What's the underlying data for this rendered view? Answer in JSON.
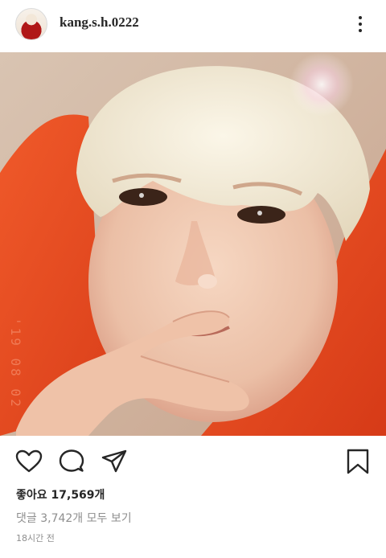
{
  "post": {
    "username": "kang.s.h.0222",
    "photo_date_stamp": "'19 08 02",
    "likes_label": "좋아요",
    "likes_count": "17,569개",
    "comments_link": "댓글 3,742개 모두 보기",
    "time_ago": "18시간 전"
  },
  "icons": {
    "like": "heart-icon",
    "comment": "comment-icon",
    "share": "paper-plane-icon",
    "save": "bookmark-icon",
    "more": "more-options-icon"
  },
  "colors": {
    "text": "#262626",
    "muted": "#8e8e8e",
    "hoodie": "#e8451e",
    "hair": "#efe6cf"
  }
}
